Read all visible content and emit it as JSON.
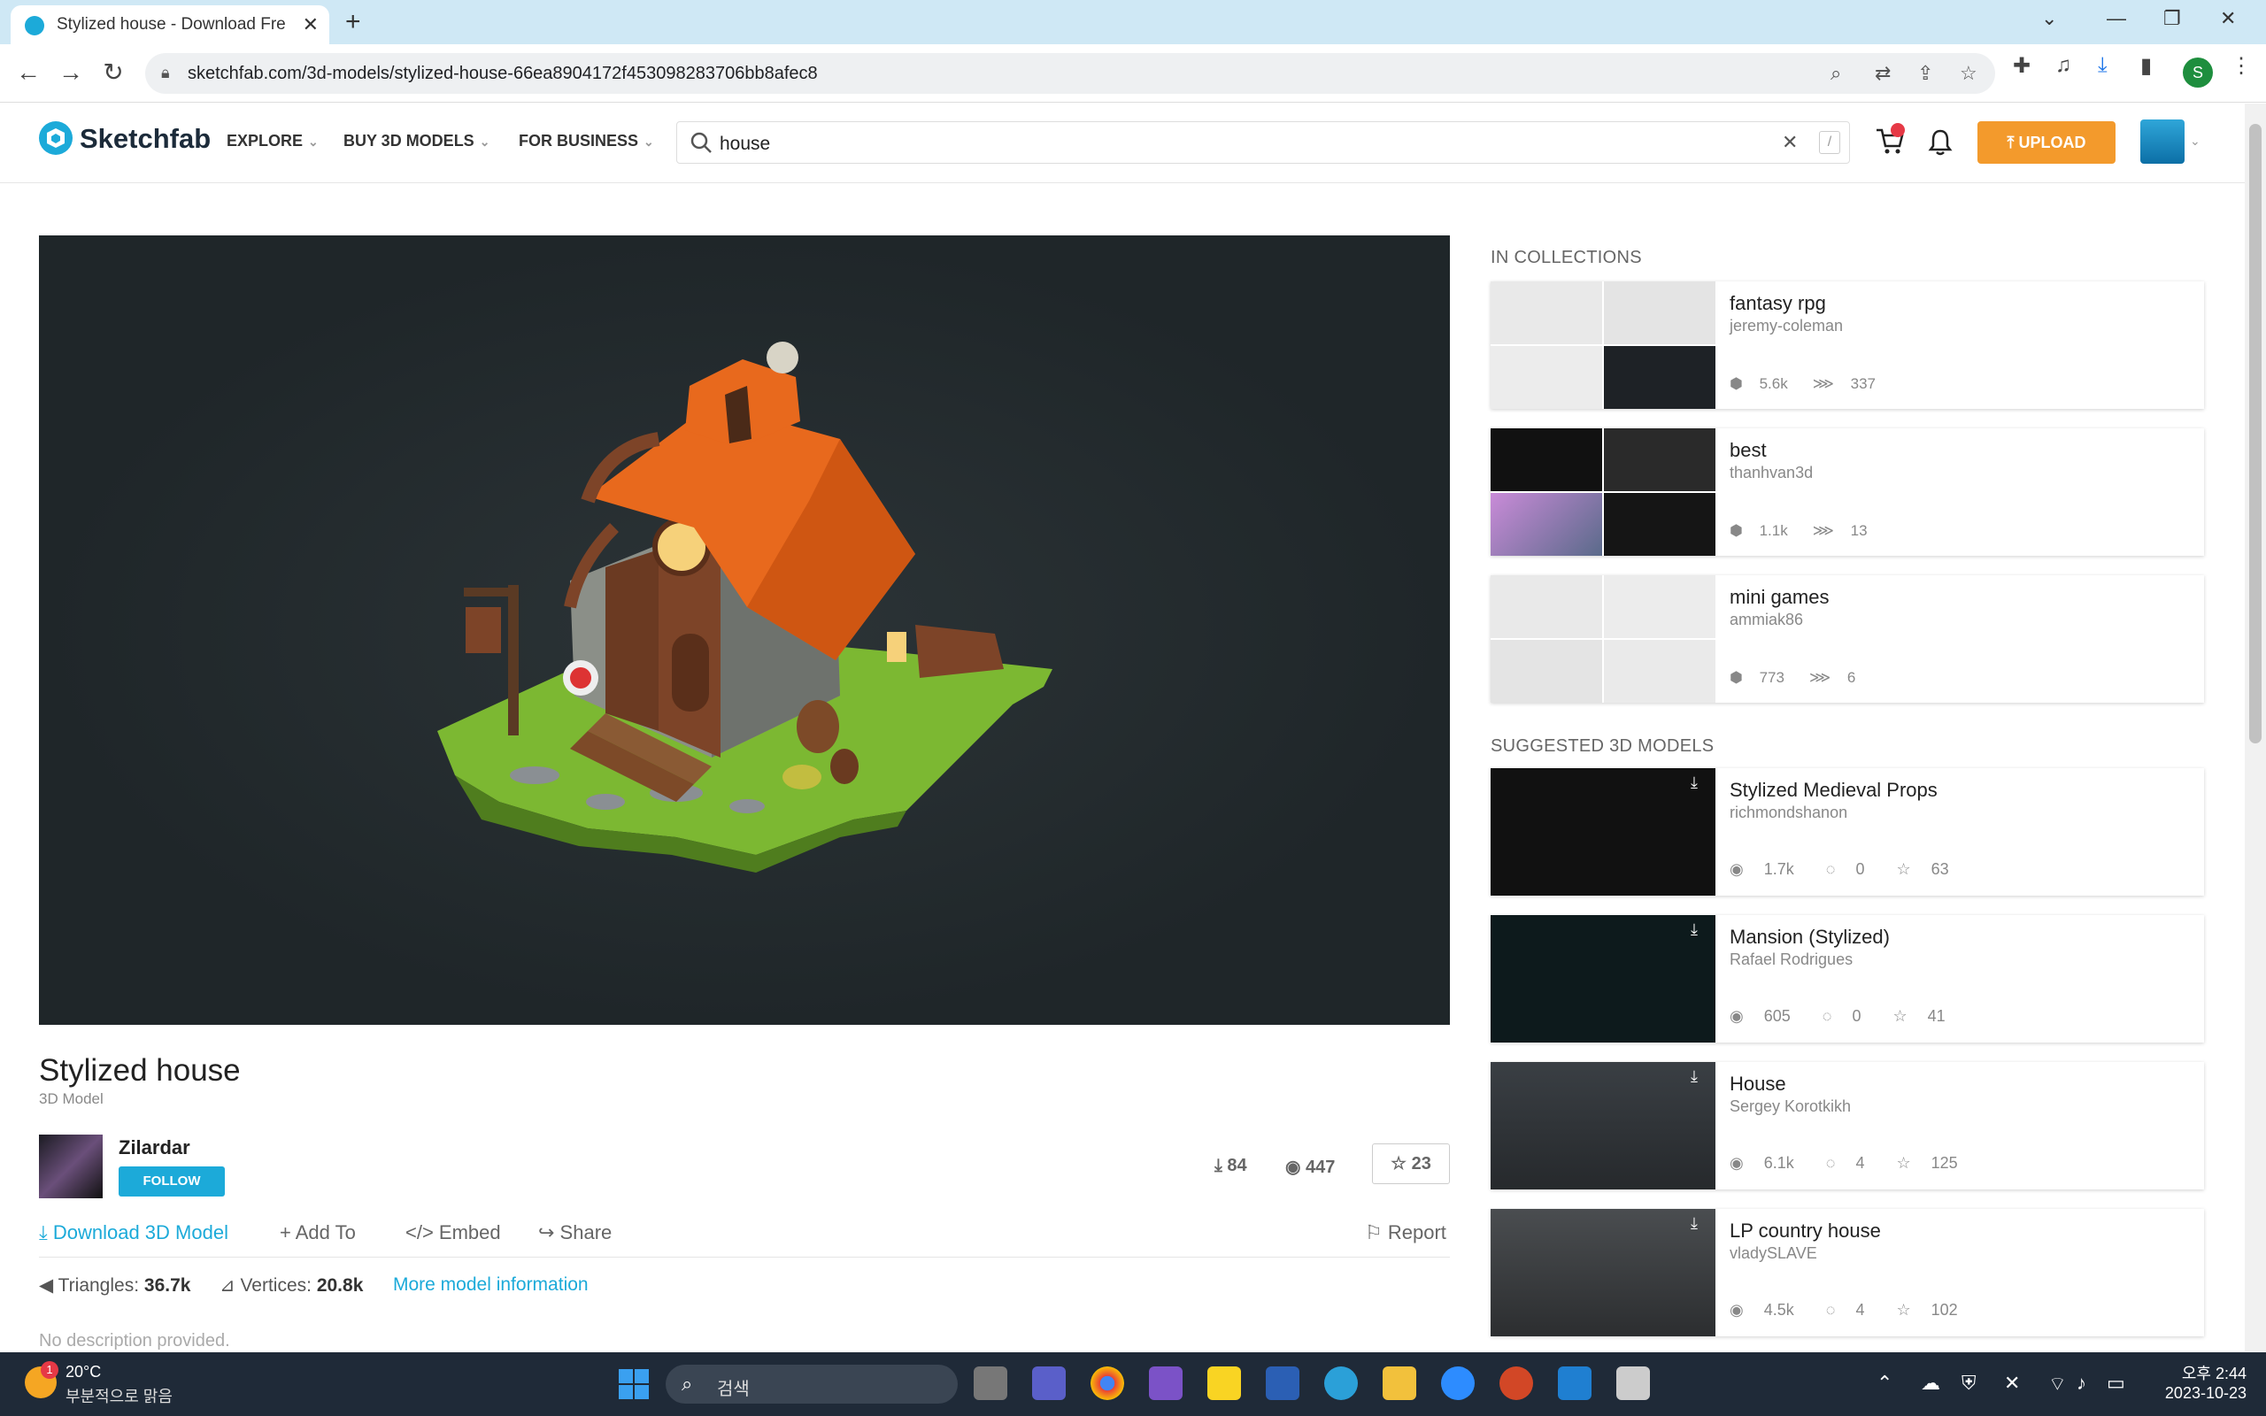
{
  "browser": {
    "tab_title": "Stylized house - Download Fre",
    "tab_close": "✕",
    "new_tab": "+",
    "url": "sketchfab.com/3d-models/stylized-house-66ea8904172f453098283706bb8afec8",
    "profile_initial": "S"
  },
  "header": {
    "logo_text": "Sketchfab",
    "nav": [
      "EXPLORE",
      "BUY 3D MODELS",
      "FOR BUSINESS"
    ],
    "search_value": "house",
    "search_clear": "✕",
    "search_shortcut": "/",
    "upload_label": "UPLOAD"
  },
  "model": {
    "title": "Stylized house",
    "type": "3D Model",
    "author": "Zilardar",
    "follow_label": "FOLLOW",
    "downloads": "84",
    "views": "447",
    "likes": "23",
    "actions": {
      "download": "Download 3D Model",
      "add_to": "Add To",
      "embed": "Embed",
      "share": "Share",
      "report": "Report"
    },
    "triangles_label": "Triangles:",
    "triangles": "36.7k",
    "vertices_label": "Vertices:",
    "vertices": "20.8k",
    "more_info": "More model information",
    "description": "No description provided."
  },
  "collections": {
    "heading": "IN COLLECTIONS",
    "items": [
      {
        "name": "fantasy rpg",
        "owner": "jeremy-coleman",
        "models": "5.6k",
        "followers": "337"
      },
      {
        "name": "best",
        "owner": "thanhvan3d",
        "models": "1.1k",
        "followers": "13"
      },
      {
        "name": "mini games",
        "owner": "ammiak86",
        "models": "773",
        "followers": "6"
      }
    ]
  },
  "suggested": {
    "heading": "SUGGESTED 3D MODELS",
    "items": [
      {
        "name": "Stylized Medieval Props",
        "owner": "richmondshanon",
        "views": "1.7k",
        "comments": "0",
        "likes": "63"
      },
      {
        "name": "Mansion (Stylized)",
        "owner": "Rafael Rodrigues",
        "views": "605",
        "comments": "0",
        "likes": "41"
      },
      {
        "name": "House",
        "owner": "Sergey Korotkikh",
        "views": "6.1k",
        "comments": "4",
        "likes": "125"
      },
      {
        "name": "LP country house",
        "owner": "vladySLAVE",
        "views": "4.5k",
        "comments": "4",
        "likes": "102"
      }
    ]
  },
  "taskbar": {
    "weather_badge": "1",
    "temperature": "20°C",
    "weather_desc": "부분적으로 맑음",
    "search_label": "검색",
    "time": "오후 2:44",
    "date": "2023-10-23"
  },
  "colors": {
    "accent": "#1caad9",
    "upload": "#f39a2c",
    "taskbar": "#1f2a38"
  }
}
